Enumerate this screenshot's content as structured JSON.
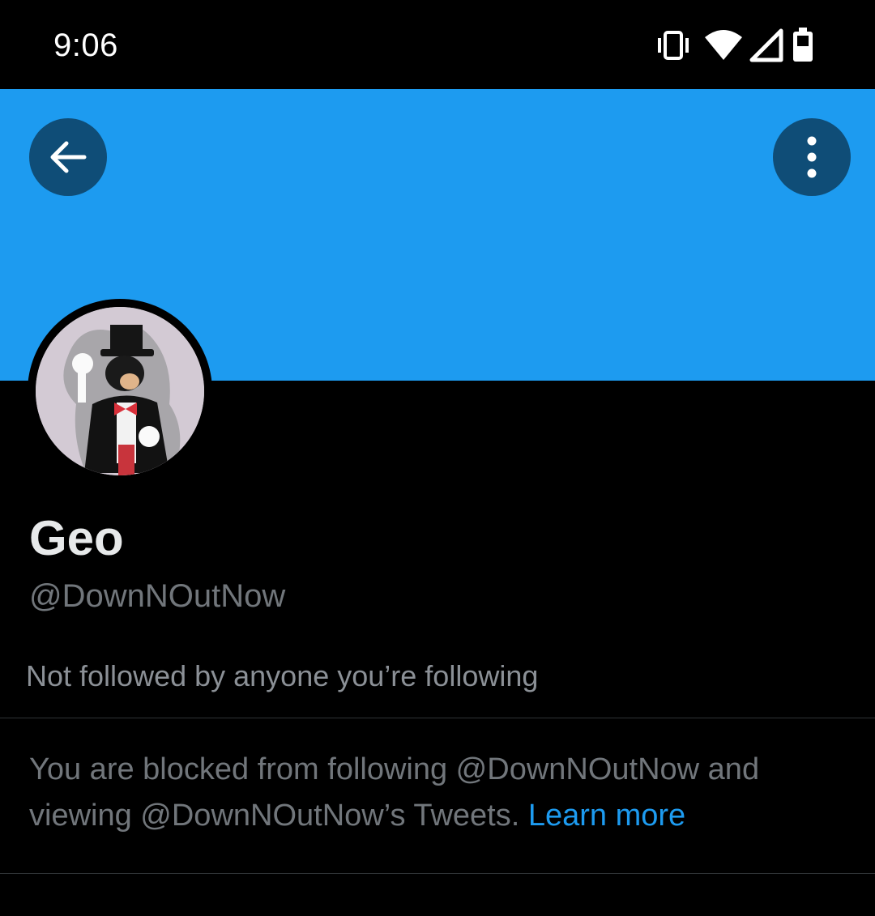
{
  "status_bar": {
    "time": "9:06",
    "icons": [
      "vibrate-icon",
      "wifi-icon",
      "signal-icon",
      "battery-icon"
    ]
  },
  "header": {
    "banner_color": "#1d9bf0",
    "back_icon": "arrow-left-icon",
    "more_icon": "more-vertical-icon"
  },
  "profile": {
    "display_name": "Geo",
    "handle": "@DownNOutNow",
    "followers_note": "Not followed by anyone you’re following"
  },
  "blocked_notice": {
    "message": "You are blocked from following @DownNOutNow and viewing @DownNOutNow’s Tweets.",
    "link_label": "Learn more",
    "link_color": "#1d9bf0"
  },
  "colors": {
    "background": "#000000",
    "accent": "#1d9bf0",
    "muted_text": "#71767b"
  }
}
